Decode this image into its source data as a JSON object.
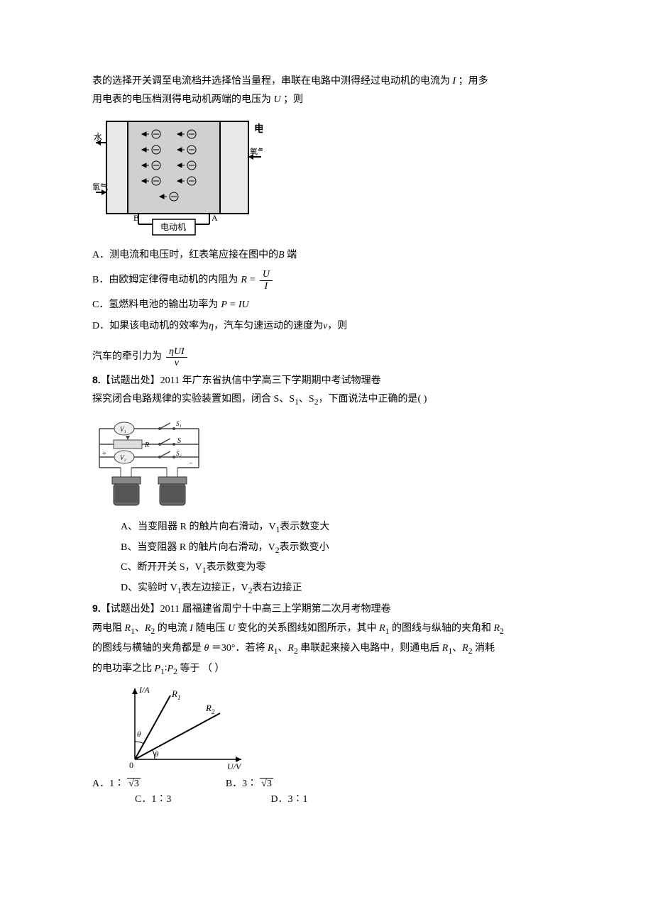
{
  "q7": {
    "intro_line1": "表的选择开关调至电流档并选择恰当量程，串联在电路中测得经过电动机的电流为",
    "intro_line1_end": "；用多",
    "intro_line2": "用电表的电压档测得电动机两端的电压为",
    "intro_line2_end": "；则",
    "var_I": "I",
    "var_U": "U",
    "diagram": {
      "battery": "电池",
      "water": "水",
      "oxygen": "氧气",
      "hydrogen": "氢气",
      "motor": "电动机",
      "termA": "A",
      "termB": "B"
    },
    "optA": "A．测电流和电压时，红表笔应接在图中的",
    "optA_end": "端",
    "optA_B": "B",
    "optB": "B．由欧姆定律得电动机的内阻为",
    "optB_R": "R",
    "optB_eq": "=",
    "optB_num": "U",
    "optB_den": "I",
    "optC": "C．氢燃料电池的输出功率为",
    "optC_P": "P",
    "optC_eq": "=",
    "optC_IU": "IU",
    "optD_1": "D．如果该电动机的效率为",
    "optD_eta": "η",
    "optD_2": "，汽车匀速运动的速度为",
    "optD_v": "v",
    "optD_3": "，则",
    "tail_text": "汽车的牵引力为",
    "tail_num": "ηUI",
    "tail_den": "v"
  },
  "q8": {
    "num": "8.",
    "source": "【试题出处】2011 年广东省执信中学高三下学期期中考试物理卷",
    "stem_a": "探究闭合电路规律的实验装置如图，闭合 S、S",
    "stem_sub1": "1",
    "stem_b": "、S",
    "stem_sub2": "2",
    "stem_c": "，下面说法中正确的是(         )",
    "diagram": {
      "V1": "V1",
      "V2": "V2",
      "R": "R",
      "S": "S",
      "S1": "S1",
      "S2": "S2"
    },
    "optA_a": "A、当变阻器 R 的触片向右滑动，V",
    "optA_b": "表示数变大",
    "sub1": "1",
    "optB_a": "B、当变阻器 R 的触片向右滑动，V",
    "optB_b": "表示数变小",
    "sub2": "2",
    "optC_a": "C、断开开关 S，V",
    "optC_b": "表示数变为零",
    "optD_a": "D、实验时 V",
    "optD_b": "表左边接正，V",
    "optD_c": "表右边接正"
  },
  "q9": {
    "num": "9.",
    "source": "【试题出处】2011 届福建省周宁十中高三上学期第二次月考物理卷",
    "stem_a": "两电阻",
    "R1": "R",
    "s1": "1",
    "stem_b": "、",
    "R2": "R",
    "s2": "2",
    "stem_c": "的电流",
    "I": "I",
    "stem_d": "随电压",
    "U": "U",
    "stem_e": "变化的关系图线如图所示，其中",
    "stem_f": "的图线与纵轴的夹角和",
    "stem_line2_a": "的图线与横轴的夹角都是",
    "theta": "θ",
    "eq30": "＝30°．若将",
    "stem_line2_b": "、",
    "stem_line2_c": "串联起来接入电路中，则通电后",
    "stem_line2_d": "消耗",
    "stem_line3_a": "的电功率之比",
    "P1": "P",
    "colon": "∶",
    "P2": "P",
    "stem_line3_b": "等于    （     ）",
    "graph": {
      "ylabel": "I/A",
      "xlabel": "U/V",
      "R1": "R",
      "R1sub": "1",
      "R2": "R",
      "R2sub": "2",
      "theta": "θ",
      "origin": "0"
    },
    "optA_a": "A．1∶",
    "root3": "3",
    "optB_a": "B．3∶",
    "optC": "C．1∶3",
    "optD": "D．3∶1"
  }
}
